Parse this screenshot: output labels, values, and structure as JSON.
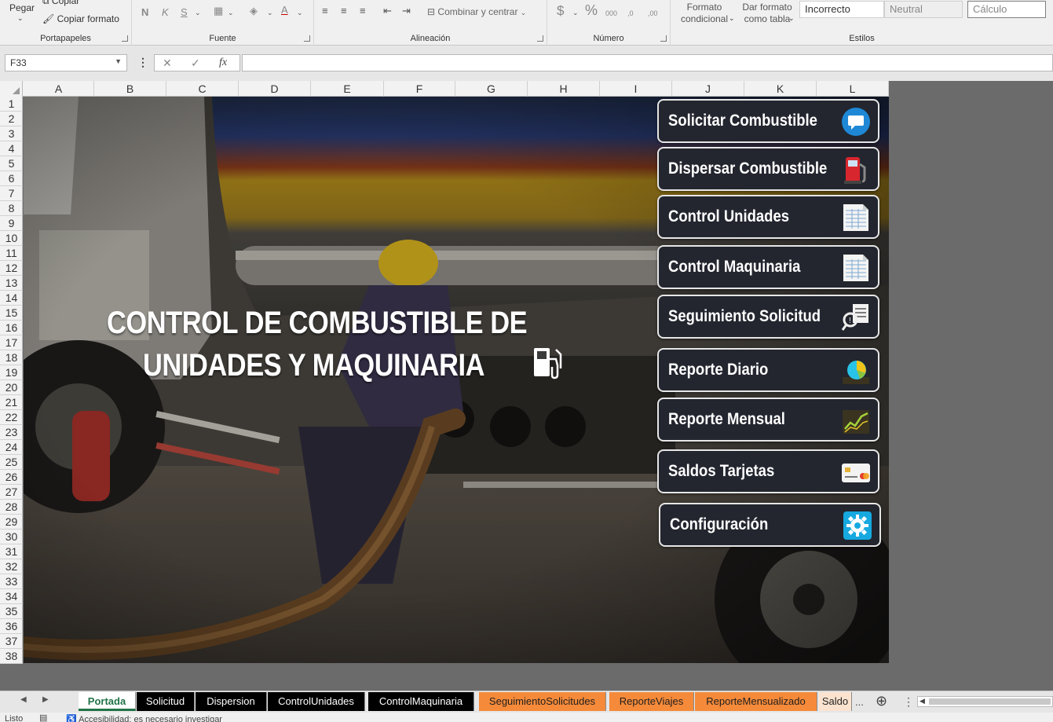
{
  "ribbon": {
    "clipboard": {
      "paste": "Pegar",
      "copy": "Copiar",
      "format_painter": "Copiar formato",
      "label": "Portapapeles"
    },
    "font": {
      "bold": "N",
      "italic": "K",
      "underline": "S",
      "label": "Fuente"
    },
    "alignment": {
      "merge": "Combinar y centrar",
      "label": "Alineación"
    },
    "number": {
      "currency": "$",
      "percent": "%",
      "thousands": "000",
      "inc_dec": ",0",
      "dec_dec": ",00",
      "label": "Número"
    },
    "styles": {
      "conditional_1": "Formato",
      "conditional_2": "condicional",
      "table_1": "Dar formato",
      "table_2": "como tabla",
      "bad": "Incorrecto",
      "neutral": "Neutral",
      "calc": "Cálculo",
      "label": "Estilos"
    }
  },
  "formula_bar": {
    "name_box": "F33",
    "fx": "fx",
    "cancel": "✕",
    "enter": "✓",
    "more": "⋮"
  },
  "columns": [
    "A",
    "B",
    "C",
    "D",
    "E",
    "F",
    "G",
    "H",
    "I",
    "J",
    "K",
    "L"
  ],
  "rows": [
    "1",
    "2",
    "3",
    "4",
    "5",
    "6",
    "7",
    "8",
    "9",
    "10",
    "11",
    "12",
    "13",
    "14",
    "15",
    "16",
    "17",
    "18",
    "19",
    "20",
    "21",
    "22",
    "23",
    "24",
    "25",
    "26",
    "27",
    "28",
    "29",
    "30",
    "31",
    "32",
    "33",
    "34",
    "35",
    "36",
    "37",
    "38"
  ],
  "cover": {
    "title_line1": "CONTROL DE COMBUSTIBLE DE",
    "title_line2": "UNIDADES Y MAQUINARIA"
  },
  "nav_buttons": [
    {
      "label": "Solicitar Combustible",
      "icon": "chat-bubble-icon"
    },
    {
      "label": "Dispersar Combustible",
      "icon": "fuel-pump-icon"
    },
    {
      "label": "Control Unidades",
      "icon": "spreadsheet-icon"
    },
    {
      "label": "Control Maquinaria",
      "icon": "spreadsheet-icon"
    },
    {
      "label": "Seguimiento Solicitud",
      "icon": "search-document-icon"
    },
    {
      "label": "Reporte Diario",
      "icon": "pie-chart-icon"
    },
    {
      "label": "Reporte Mensual",
      "icon": "line-chart-icon"
    },
    {
      "label": "Saldos Tarjetas",
      "icon": "credit-card-icon"
    },
    {
      "label": "Configuración",
      "icon": "gear-icon"
    }
  ],
  "sheet_tabs": [
    {
      "label": "Portada",
      "style": "active"
    },
    {
      "label": "Solicitud",
      "style": "black"
    },
    {
      "label": "Dispersion",
      "style": "black"
    },
    {
      "label": "ControlUnidades",
      "style": "black"
    },
    {
      "label": "ControlMaquinaria",
      "style": "black"
    },
    {
      "label": "SeguimientoSolicitudes",
      "style": "orange"
    },
    {
      "label": "ReporteViajes",
      "style": "orange"
    },
    {
      "label": "ReporteMensualizado",
      "style": "orange"
    },
    {
      "label": "Saldo",
      "style": "peach"
    }
  ],
  "tab_more": "...",
  "status": {
    "ready": "Listo",
    "accessibility": "Accesibilidad: es necesario investigar"
  },
  "colors": {
    "tab_orange": "#f58a3a",
    "tab_black": "#000000",
    "active_green": "#217346",
    "button_bg": "#23262f"
  }
}
